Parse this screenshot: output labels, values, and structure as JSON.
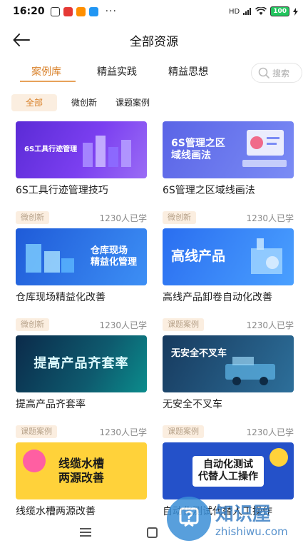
{
  "status": {
    "time": "16:20",
    "more": "···",
    "network": "HD",
    "battery": "100"
  },
  "header": {
    "title": "全部资源"
  },
  "tabs": [
    {
      "label": "案例库",
      "active": true
    },
    {
      "label": "精益实践",
      "active": false
    },
    {
      "label": "精益思想",
      "active": false
    }
  ],
  "search": {
    "placeholder": "搜索"
  },
  "filters": [
    {
      "label": "全部",
      "active": true
    },
    {
      "label": "微创新",
      "active": false
    },
    {
      "label": "课题案例",
      "active": false
    }
  ],
  "cards": [
    {
      "tag": "",
      "learners": "",
      "thumb_text": "6S工具行迹管理",
      "title": "6S工具行迹管理技巧"
    },
    {
      "tag": "",
      "learners": "",
      "thumb_text": "6S管理之区\n域线画法",
      "title": "6S管理之区域线画法"
    },
    {
      "tag": "微创新",
      "learners": "1230人已学",
      "thumb_text": "仓库现场\n精益化管理",
      "title": "仓库现场精益化改善"
    },
    {
      "tag": "微创新",
      "learners": "1230人已学",
      "thumb_text": "高线产品",
      "title": "高线产品卸卷自动化改善"
    },
    {
      "tag": "微创新",
      "learners": "1230人已学",
      "thumb_text": "提高产品齐套率",
      "title": "提高产品齐套率"
    },
    {
      "tag": "课题案例",
      "learners": "1230人已学",
      "thumb_text": "无安全不叉车",
      "title": "无安全不叉车"
    },
    {
      "tag": "课题案例",
      "learners": "1230人已学",
      "thumb_text": "线缆水槽\n两源改善",
      "title": "线缆水槽两源改善"
    },
    {
      "tag": "课题案例",
      "learners": "1230人已学",
      "thumb_text": "自动化测试\n代替人工操作",
      "title": "自动化测试代替人工操作"
    }
  ],
  "watermark": {
    "text": "知识屋",
    "url": "zhishiwu.com"
  },
  "colors": {
    "accent": "#d9822b",
    "tag_bg": "#fbeee0"
  }
}
